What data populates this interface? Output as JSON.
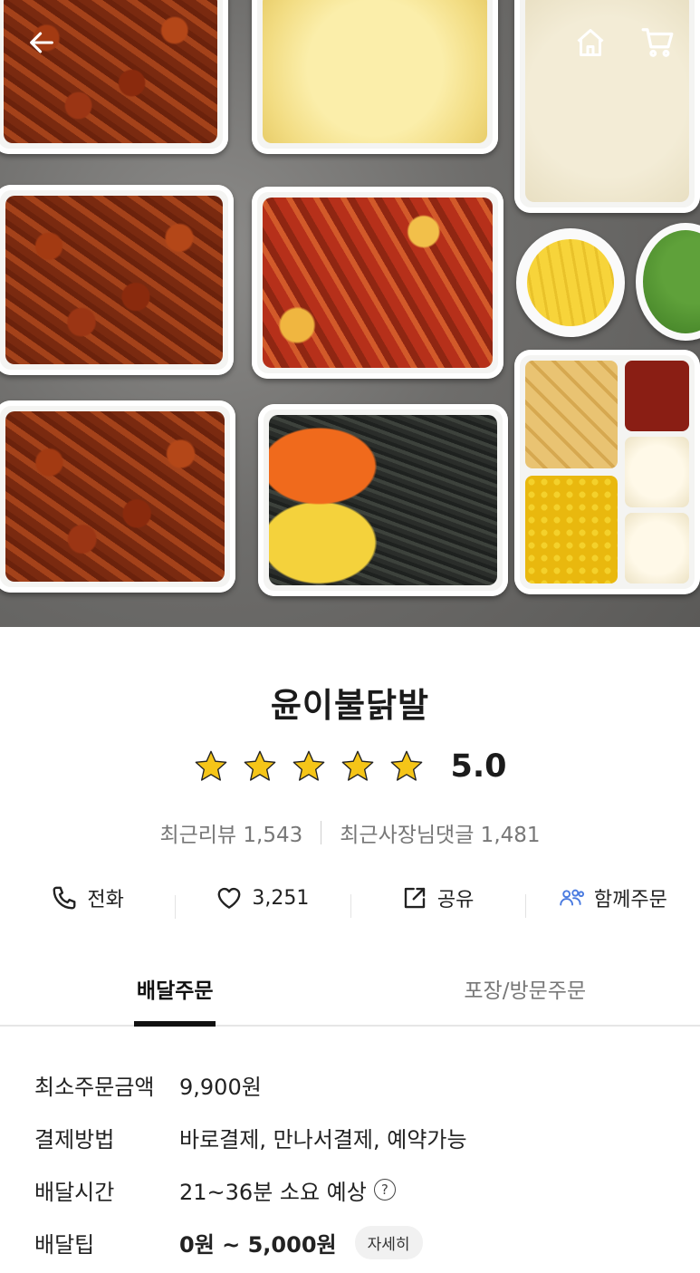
{
  "store": {
    "name": "윤이불닭발",
    "rating": "5.0",
    "stars": 5,
    "recent_reviews": "최근리뷰 1,543",
    "owner_replies": "최근사장님댓글 1,481"
  },
  "hero": {
    "back_icon": "back-arrow-icon",
    "home_icon": "home-icon",
    "cart_icon": "cart-icon"
  },
  "actions": [
    {
      "label": "전화",
      "icon": "phone-icon"
    },
    {
      "label": "3,251",
      "icon": "heart-icon"
    },
    {
      "label": "공유",
      "icon": "share-icon"
    },
    {
      "label": "함께주문",
      "icon": "group-icon"
    }
  ],
  "tabs": {
    "delivery": "배달주문",
    "pickup": "포장/방문주문",
    "active": "delivery"
  },
  "info": {
    "min_order_label": "최소주문금액",
    "min_order_value": "9,900원",
    "payment_label": "결제방법",
    "payment_value": "바로결제, 만나서결제, 예약가능",
    "delivery_time_label": "배달시간",
    "delivery_time_value": "21~36분 소요 예상",
    "delivery_tip_label": "배달팁",
    "delivery_tip_value": "0원 ~ 5,000원",
    "detail_button": "자세히"
  },
  "colors": {
    "star": "#F5C518",
    "group_icon": "#4A7BE0",
    "text": "#222222",
    "muted": "#777777"
  }
}
